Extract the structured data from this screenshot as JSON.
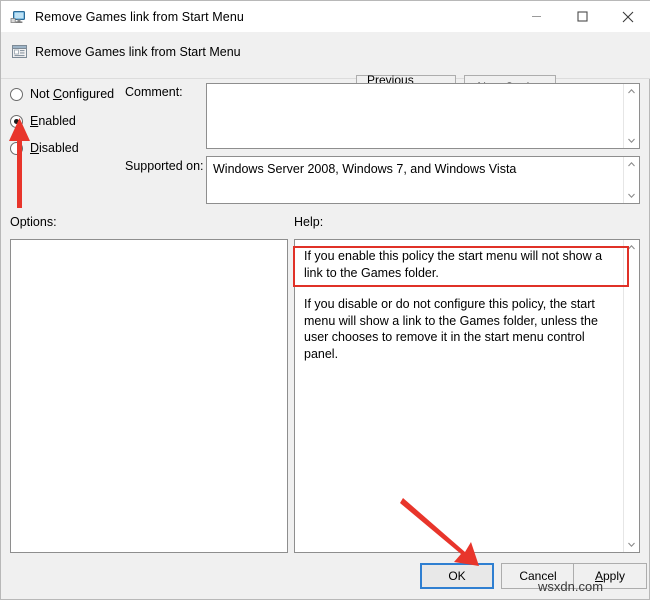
{
  "window": {
    "title": "Remove Games link from Start Menu",
    "icon": "monitor-policy-icon",
    "controls": {
      "minimize": "minimize-icon",
      "maximize": "maximize-icon",
      "close": "close-icon"
    }
  },
  "header": {
    "icon": "policy-setting-icon",
    "title": "Remove Games link from Start Menu",
    "previous_setting": "Previous Setting",
    "previous_setting_accel": "P",
    "next_setting": "Next Setting",
    "next_setting_accel": "N"
  },
  "state_options": [
    {
      "label": "Not Configured",
      "accel": "C",
      "selected": false,
      "name": "not-configured"
    },
    {
      "label": "Enabled",
      "accel": "E",
      "selected": true,
      "name": "enabled"
    },
    {
      "label": "Disabled",
      "accel": "D",
      "selected": false,
      "name": "disabled"
    }
  ],
  "comment": {
    "label": "Comment:",
    "value": "",
    "placeholder": ""
  },
  "supported_on": {
    "label": "Supported on:",
    "value": "Windows Server 2008, Windows 7, and Windows Vista"
  },
  "options": {
    "label": "Options:",
    "content": ""
  },
  "help": {
    "label": "Help:",
    "paragraphs": [
      "If you enable this policy the start menu will not show a link to the Games folder.",
      "If you disable or do not configure this policy, the start menu will show a link to the Games folder, unless the user chooses to remove it in the start menu control panel."
    ]
  },
  "footer": {
    "ok": "OK",
    "cancel": "Cancel",
    "apply": "Apply",
    "apply_accel": "A",
    "focused": "OK"
  },
  "annotations": {
    "highlight_color": "#e03127",
    "focus_color": "#2f7fd1",
    "arrow_radio_target": "enabled-radio",
    "arrow_ok_target": "ok-button",
    "help_box_target": "help-first-paragraph"
  },
  "watermark": "wsxdn.com"
}
